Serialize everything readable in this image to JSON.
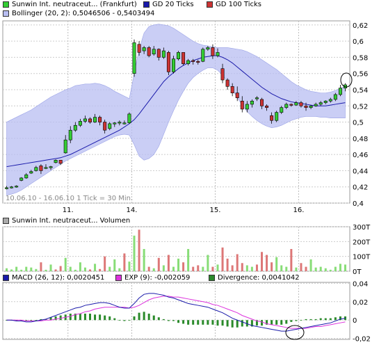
{
  "legends": {
    "top": [
      {
        "label": "Sunwin Int. neutraceut... (Frankfurt)",
        "color": "#33cc33"
      },
      {
        "label": "GD 20 Ticks",
        "color": "#1a1aaa"
      },
      {
        "label": "GD 100 Ticks",
        "color": "#cc3333"
      }
    ],
    "bollinger": {
      "label": "Bollinger (20, 2): 0,5046506 - 0,5403494",
      "color": "#b8bef2"
    },
    "volume": {
      "label": "Sunwin Int. neutraceut... Volumen",
      "color": "#aaaaaa"
    },
    "macd": [
      {
        "label": "MACD (26, 12): 0,0020451",
        "color": "#1a1aaa"
      },
      {
        "label": "EXP (9): -0,002059",
        "color": "#dd33dd"
      },
      {
        "label": "Divergence: 0,0041042",
        "color": "#2a8a2a"
      }
    ]
  },
  "range_note": "10.06.10 - 16.06.10   1 Tick = 30 Min.",
  "chart_data": [
    {
      "type": "candlestick",
      "x_ticks": [
        "11.",
        "14.",
        "15.",
        "16."
      ],
      "y_ticks": [
        "0,4",
        "0,42",
        "0,44",
        "0,46",
        "0,48",
        "0,5",
        "0,52",
        "0,54",
        "0,56",
        "0,58",
        "0,6",
        "0,62"
      ],
      "ylim": [
        0.4,
        0.625
      ],
      "ohlc": [
        [
          0.418,
          0.421,
          0.417,
          0.419
        ],
        [
          0.419,
          0.421,
          0.418,
          0.42
        ],
        [
          0.42,
          0.422,
          0.419,
          0.421
        ],
        [
          0.428,
          0.432,
          0.427,
          0.431
        ],
        [
          0.431,
          0.437,
          0.43,
          0.435
        ],
        [
          0.437,
          0.441,
          0.436,
          0.439
        ],
        [
          0.44,
          0.446,
          0.439,
          0.444
        ],
        [
          0.446,
          0.448,
          0.436,
          0.44
        ],
        [
          0.444,
          0.448,
          0.442,
          0.444
        ],
        [
          0.444,
          0.446,
          0.441,
          0.445
        ],
        [
          0.45,
          0.454,
          0.449,
          0.453
        ],
        [
          0.453,
          0.452,
          0.447,
          0.449
        ],
        [
          0.462,
          0.484,
          0.461,
          0.478
        ],
        [
          0.478,
          0.495,
          0.474,
          0.49
        ],
        [
          0.49,
          0.5,
          0.488,
          0.496
        ],
        [
          0.496,
          0.504,
          0.494,
          0.501
        ],
        [
          0.501,
          0.508,
          0.499,
          0.504
        ],
        [
          0.504,
          0.506,
          0.498,
          0.5
        ],
        [
          0.5,
          0.51,
          0.499,
          0.506
        ],
        [
          0.506,
          0.508,
          0.496,
          0.5
        ],
        [
          0.5,
          0.503,
          0.486,
          0.49
        ],
        [
          0.492,
          0.5,
          0.49,
          0.498
        ],
        [
          0.498,
          0.5,
          0.494,
          0.499
        ],
        [
          0.499,
          0.502,
          0.496,
          0.5
        ],
        [
          0.498,
          0.502,
          0.497,
          0.499
        ],
        [
          0.499,
          0.512,
          0.498,
          0.51
        ],
        [
          0.56,
          0.602,
          0.556,
          0.598
        ],
        [
          0.596,
          0.6,
          0.582,
          0.586
        ],
        [
          0.588,
          0.594,
          0.584,
          0.592
        ],
        [
          0.592,
          0.594,
          0.58,
          0.582
        ],
        [
          0.584,
          0.594,
          0.582,
          0.59
        ],
        [
          0.59,
          0.591,
          0.576,
          0.58
        ],
        [
          0.58,
          0.592,
          0.578,
          0.588
        ],
        [
          0.586,
          0.588,
          0.558,
          0.562
        ],
        [
          0.562,
          0.582,
          0.56,
          0.578
        ],
        [
          0.578,
          0.588,
          0.576,
          0.586
        ],
        [
          0.586,
          0.586,
          0.57,
          0.572
        ],
        [
          0.572,
          0.578,
          0.57,
          0.576
        ],
        [
          0.576,
          0.578,
          0.571,
          0.575
        ],
        [
          0.575,
          0.577,
          0.571,
          0.574
        ],
        [
          0.575,
          0.592,
          0.574,
          0.59
        ],
        [
          0.59,
          0.594,
          0.588,
          0.592
        ],
        [
          0.592,
          0.596,
          0.578,
          0.582
        ],
        [
          0.582,
          0.591,
          0.58,
          0.586
        ],
        [
          0.566,
          0.572,
          0.548,
          0.552
        ],
        [
          0.552,
          0.554,
          0.54,
          0.544
        ],
        [
          0.544,
          0.548,
          0.532,
          0.536
        ],
        [
          0.536,
          0.544,
          0.526,
          0.53
        ],
        [
          0.526,
          0.532,
          0.512,
          0.516
        ],
        [
          0.516,
          0.526,
          0.512,
          0.522
        ],
        [
          0.522,
          0.528,
          0.518,
          0.526
        ],
        [
          0.53,
          0.532,
          0.526,
          0.53
        ],
        [
          0.528,
          0.53,
          0.516,
          0.52
        ],
        [
          0.52,
          0.522,
          0.514,
          0.518
        ],
        [
          0.508,
          0.512,
          0.498,
          0.502
        ],
        [
          0.502,
          0.514,
          0.5,
          0.512
        ],
        [
          0.512,
          0.52,
          0.51,
          0.518
        ],
        [
          0.518,
          0.524,
          0.516,
          0.522
        ],
        [
          0.522,
          0.523,
          0.519,
          0.521
        ],
        [
          0.521,
          0.526,
          0.52,
          0.524
        ],
        [
          0.524,
          0.526,
          0.518,
          0.52
        ],
        [
          0.52,
          0.524,
          0.514,
          0.518
        ],
        [
          0.518,
          0.521,
          0.516,
          0.52
        ],
        [
          0.52,
          0.524,
          0.519,
          0.522
        ],
        [
          0.522,
          0.526,
          0.52,
          0.524
        ],
        [
          0.524,
          0.527,
          0.522,
          0.526
        ],
        [
          0.526,
          0.53,
          0.524,
          0.528
        ],
        [
          0.528,
          0.536,
          0.526,
          0.534
        ],
        [
          0.534,
          0.546,
          0.532,
          0.542
        ],
        [
          0.542,
          0.548,
          0.538,
          0.546
        ]
      ],
      "series": [
        {
          "name": "GD 20 Ticks",
          "values": [
            0.445,
            0.446,
            0.447,
            0.448,
            0.449,
            0.45,
            0.451,
            0.452,
            0.453,
            0.454,
            0.455,
            0.456,
            0.458,
            0.46,
            0.463,
            0.466,
            0.469,
            0.472,
            0.475,
            0.478,
            0.481,
            0.484,
            0.487,
            0.49,
            0.494,
            0.498,
            0.503,
            0.51,
            0.518,
            0.526,
            0.534,
            0.542,
            0.55,
            0.556,
            0.561,
            0.566,
            0.57,
            0.573,
            0.576,
            0.578,
            0.58,
            0.581,
            0.582,
            0.582,
            0.58,
            0.577,
            0.573,
            0.568,
            0.563,
            0.558,
            0.553,
            0.548,
            0.543,
            0.539,
            0.535,
            0.532,
            0.529,
            0.527,
            0.525,
            0.524,
            0.523,
            0.522,
            0.521,
            0.52,
            0.52,
            0.52,
            0.521,
            0.522,
            0.523,
            0.524
          ]
        },
        {
          "name": "Bollinger upper",
          "values": [
            0.5,
            0.503,
            0.506,
            0.509,
            0.512,
            0.515,
            0.519,
            0.523,
            0.527,
            0.531,
            0.534,
            0.537,
            0.54,
            0.542,
            0.545,
            0.546,
            0.547,
            0.547,
            0.548,
            0.547,
            0.545,
            0.542,
            0.538,
            0.535,
            0.532,
            0.529,
            0.56,
            0.59,
            0.61,
            0.618,
            0.62,
            0.621,
            0.62,
            0.619,
            0.616,
            0.612,
            0.608,
            0.604,
            0.6,
            0.597,
            0.595,
            0.594,
            0.593,
            0.592,
            0.592,
            0.592,
            0.591,
            0.59,
            0.589,
            0.587,
            0.584,
            0.581,
            0.577,
            0.573,
            0.569,
            0.565,
            0.56,
            0.555,
            0.55,
            0.546,
            0.543,
            0.54,
            0.538,
            0.537,
            0.536,
            0.536,
            0.537,
            0.539,
            0.542,
            0.544
          ]
        },
        {
          "name": "Bollinger lower",
          "values": [
            0.41,
            0.411,
            0.413,
            0.416,
            0.42,
            0.424,
            0.428,
            0.432,
            0.436,
            0.44,
            0.444,
            0.448,
            0.452,
            0.455,
            0.458,
            0.461,
            0.464,
            0.467,
            0.47,
            0.473,
            0.476,
            0.479,
            0.482,
            0.484,
            0.485,
            0.484,
            0.472,
            0.458,
            0.453,
            0.455,
            0.46,
            0.47,
            0.485,
            0.5,
            0.514,
            0.527,
            0.538,
            0.548,
            0.555,
            0.56,
            0.564,
            0.567,
            0.567,
            0.564,
            0.558,
            0.55,
            0.54,
            0.53,
            0.521,
            0.513,
            0.507,
            0.502,
            0.498,
            0.495,
            0.493,
            0.494,
            0.496,
            0.499,
            0.502,
            0.504,
            0.506,
            0.507,
            0.507,
            0.507,
            0.506,
            0.506,
            0.505,
            0.505,
            0.505,
            0.505
          ]
        }
      ]
    },
    {
      "type": "bar",
      "y_ticks": [
        "0T",
        "100T",
        "200T",
        "300T"
      ],
      "ylim": [
        0,
        300
      ],
      "values": [
        20,
        12,
        30,
        10,
        30,
        25,
        15,
        60,
        10,
        45,
        12,
        35,
        90,
        30,
        10,
        60,
        25,
        12,
        50,
        15,
        100,
        30,
        80,
        20,
        120,
        65,
        240,
        280,
        150,
        30,
        20,
        90,
        40,
        110,
        30,
        85,
        60,
        150,
        30,
        40,
        30,
        110,
        30,
        45,
        160,
        85,
        40,
        115,
        55,
        40,
        30,
        45,
        130,
        110,
        60,
        95,
        40,
        30,
        150,
        25,
        55,
        30,
        80,
        25,
        30,
        20,
        10,
        30,
        50,
        45
      ],
      "up": [
        true,
        true,
        true,
        true,
        true,
        true,
        true,
        false,
        true,
        true,
        false,
        false,
        true,
        true,
        true,
        true,
        true,
        false,
        true,
        false,
        false,
        true,
        true,
        true,
        false,
        true,
        true,
        false,
        true,
        false,
        true,
        false,
        true,
        false,
        true,
        true,
        false,
        true,
        false,
        false,
        true,
        true,
        false,
        true,
        false,
        false,
        false,
        false,
        false,
        true,
        true,
        false,
        false,
        false,
        false,
        true,
        true,
        true,
        false,
        true,
        false,
        false,
        true,
        true,
        true,
        true,
        true,
        true,
        true,
        true
      ]
    },
    {
      "type": "line",
      "y_ticks": [
        "-0,02",
        "0",
        "0,02",
        "0,04"
      ],
      "ylim": [
        -0.021,
        0.041
      ],
      "series": [
        {
          "name": "MACD (26, 12)",
          "values": [
            0.0,
            0.0,
            -0.001,
            -0.001,
            -0.002,
            -0.002,
            -0.001,
            0.0,
            0.001,
            0.003,
            0.005,
            0.007,
            0.009,
            0.011,
            0.013,
            0.014,
            0.016,
            0.017,
            0.018,
            0.019,
            0.019,
            0.018,
            0.016,
            0.014,
            0.013,
            0.013,
            0.018,
            0.024,
            0.028,
            0.029,
            0.029,
            0.028,
            0.027,
            0.025,
            0.024,
            0.022,
            0.02,
            0.018,
            0.017,
            0.016,
            0.015,
            0.014,
            0.012,
            0.01,
            0.008,
            0.005,
            0.002,
            0.0,
            -0.002,
            -0.004,
            -0.006,
            -0.007,
            -0.008,
            -0.009,
            -0.01,
            -0.011,
            -0.012,
            -0.012,
            -0.011,
            -0.01,
            -0.009,
            -0.008,
            -0.007,
            -0.006,
            -0.005,
            -0.004,
            -0.003,
            -0.001,
            0.001,
            0.002
          ]
        },
        {
          "name": "EXP (9)",
          "values": [
            0.0,
            0.0,
            0.0,
            0.0,
            -0.001,
            -0.001,
            -0.001,
            -0.001,
            0.0,
            0.0,
            0.001,
            0.002,
            0.003,
            0.004,
            0.006,
            0.007,
            0.009,
            0.01,
            0.012,
            0.013,
            0.014,
            0.014,
            0.014,
            0.014,
            0.014,
            0.013,
            0.014,
            0.016,
            0.019,
            0.022,
            0.024,
            0.025,
            0.026,
            0.026,
            0.025,
            0.025,
            0.024,
            0.023,
            0.022,
            0.021,
            0.02,
            0.019,
            0.017,
            0.016,
            0.014,
            0.012,
            0.01,
            0.008,
            0.005,
            0.003,
            0.001,
            -0.001,
            -0.002,
            -0.004,
            -0.005,
            -0.006,
            -0.007,
            -0.008,
            -0.009,
            -0.009,
            -0.009,
            -0.009,
            -0.008,
            -0.007,
            -0.007,
            -0.006,
            -0.005,
            -0.004,
            -0.003,
            -0.002
          ]
        },
        {
          "name": "Divergence",
          "values": [
            0.0,
            0.0,
            -0.001,
            -0.001,
            -0.001,
            -0.001,
            0.0,
            0.001,
            0.001,
            0.003,
            0.004,
            0.005,
            0.006,
            0.007,
            0.007,
            0.007,
            0.007,
            0.007,
            0.006,
            0.006,
            0.005,
            0.004,
            0.002,
            0.0,
            -0.001,
            0.0,
            0.004,
            0.008,
            0.009,
            0.007,
            0.005,
            0.003,
            0.001,
            -0.001,
            -0.001,
            -0.003,
            -0.004,
            -0.005,
            -0.005,
            -0.005,
            -0.005,
            -0.005,
            -0.005,
            -0.006,
            -0.006,
            -0.007,
            -0.008,
            -0.008,
            -0.007,
            -0.007,
            -0.007,
            -0.006,
            -0.006,
            -0.005,
            -0.005,
            -0.005,
            -0.005,
            -0.004,
            -0.002,
            -0.001,
            0.0,
            0.001,
            0.001,
            0.001,
            0.002,
            0.002,
            0.002,
            0.003,
            0.004,
            0.004
          ]
        }
      ]
    }
  ]
}
